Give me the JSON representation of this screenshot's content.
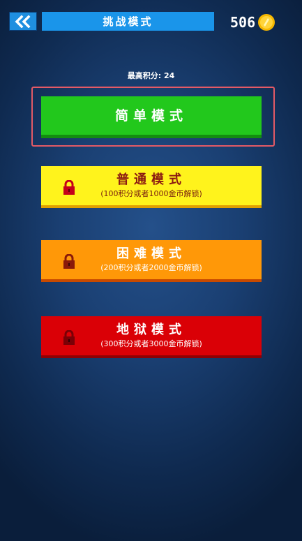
{
  "header": {
    "title": "挑战模式",
    "coin_count": "506",
    "back_icon": "double-chevron-left-icon",
    "coin_icon": "gold-coin-icon"
  },
  "best_score_label": "最高积分: 24",
  "modes": [
    {
      "name": "简单模式",
      "requirement": "",
      "locked": false,
      "color": "#22c81c"
    },
    {
      "name": "普通模式",
      "requirement": "(100积分或者1000金币解锁)",
      "locked": true,
      "color": "#fff31c"
    },
    {
      "name": "困难模式",
      "requirement": "(200积分或者2000金币解锁)",
      "locked": true,
      "color": "#ff9808"
    },
    {
      "name": "地狱模式",
      "requirement": "(300积分或者3000金币解锁)",
      "locked": true,
      "color": "#da0006"
    }
  ],
  "colors": {
    "highlight": "#e45a66",
    "header_blue": "#1a95ea",
    "lock_red": "#c4001a"
  }
}
